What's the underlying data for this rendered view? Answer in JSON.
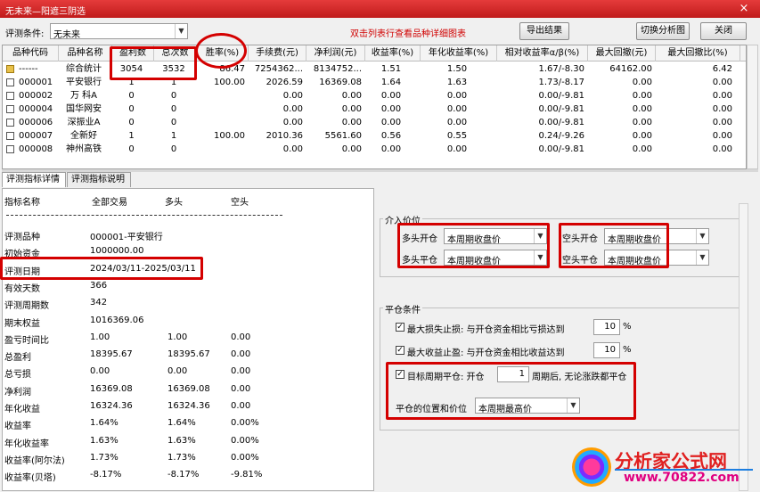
{
  "window": {
    "title": "无未来—阳遮三阴选",
    "close_label": "×"
  },
  "toolbar": {
    "condition_label": "评测条件:",
    "condition_value": "无未来",
    "hint": "双击列表行查看品种详细图表",
    "export_label": "导出结果",
    "switch_label": "切换分析图",
    "close_label": "关闭"
  },
  "grid": {
    "headers": [
      "品种代码",
      "品种名称",
      "盈利数",
      "总次数",
      "胜率(%)",
      "手续费(元)",
      "净利润(元)",
      "收益率(%)",
      "年化收益率(%)",
      "相对收益率α/β(%)",
      "最大回撤(元)",
      "最大回撤比(%)"
    ],
    "rows": [
      [
        "------",
        "综合统计",
        "3054",
        "3532",
        "86.47",
        "7254362...",
        "8134752...",
        "1.51",
        "1.50",
        "1.67/-8.30",
        "64162.00",
        "6.42"
      ],
      [
        "000001",
        "平安银行",
        "1",
        "1",
        "100.00",
        "2026.59",
        "16369.08",
        "1.64",
        "1.63",
        "1.73/-8.17",
        "0.00",
        "0.00"
      ],
      [
        "000002",
        "万 科A",
        "0",
        "0",
        "",
        "0.00",
        "0.00",
        "0.00",
        "0.00",
        "0.00/-9.81",
        "0.00",
        "0.00"
      ],
      [
        "000004",
        "国华网安",
        "0",
        "0",
        "",
        "0.00",
        "0.00",
        "0.00",
        "0.00",
        "0.00/-9.81",
        "0.00",
        "0.00"
      ],
      [
        "000006",
        "深振业A",
        "0",
        "0",
        "",
        "0.00",
        "0.00",
        "0.00",
        "0.00",
        "0.00/-9.81",
        "0.00",
        "0.00"
      ],
      [
        "000007",
        "全新好",
        "1",
        "1",
        "100.00",
        "2010.36",
        "5561.60",
        "0.56",
        "0.55",
        "0.24/-9.26",
        "0.00",
        "0.00"
      ],
      [
        "000008",
        "神州高铁",
        "0",
        "0",
        "",
        "0.00",
        "0.00",
        "0.00",
        "0.00",
        "0.00/-9.81",
        "0.00",
        "0.00"
      ]
    ]
  },
  "tabs": [
    "评测指标详情",
    "评测指标说明"
  ],
  "detail": {
    "col_headers": [
      "指标名称",
      "全部交易",
      "多头",
      "空头"
    ],
    "rows": [
      [
        "评测品种",
        "000001-平安银行",
        "",
        ""
      ],
      [
        "初始资金",
        "1000000.00",
        "",
        ""
      ],
      [
        "评测日期",
        "2024/03/11-2025/03/11",
        "",
        ""
      ],
      [
        "有效天数",
        "366",
        "",
        ""
      ],
      [
        "评测周期数",
        "342",
        "",
        ""
      ],
      [
        "期末权益",
        "1016369.06",
        "",
        ""
      ],
      [
        "盈亏时间比",
        "1.00",
        "1.00",
        "0.00"
      ],
      [
        "总盈利",
        "18395.67",
        "18395.67",
        "0.00"
      ],
      [
        "总亏损",
        "0.00",
        "0.00",
        "0.00"
      ],
      [
        "净利润",
        "16369.08",
        "16369.08",
        "0.00"
      ],
      [
        "年化收益",
        "16324.36",
        "16324.36",
        "0.00"
      ],
      [
        "收益率",
        "1.64%",
        "1.64%",
        "0.00%"
      ],
      [
        "年化收益率",
        "1.63%",
        "1.63%",
        "0.00%"
      ],
      [
        "收益率(阿尔法)",
        "1.73%",
        "1.73%",
        "0.00%"
      ],
      [
        "收益率(贝塔)",
        "-8.17%",
        "-8.17%",
        "-9.81%"
      ]
    ]
  },
  "entry_price": {
    "title": "介入价位",
    "long_open_label": "多头开仓",
    "long_open_value": "本周期收盘价",
    "short_open_label": "空头开仓",
    "short_open_value": "本周期收盘价",
    "long_close_label": "多头平仓",
    "long_close_value": "本周期收盘价",
    "short_close_label": "空头平仓",
    "short_close_value": "本周期收盘价"
  },
  "close_conditions": {
    "title": "平仓条件",
    "stop_loss_label": "最大损失止损: 与开仓资金相比亏损达到",
    "stop_loss_value": "10",
    "stop_loss_unit": "%",
    "take_profit_label": "最大收益止盈: 与开仓资金相比收益达到",
    "take_profit_value": "10",
    "take_profit_unit": "%",
    "target_period_label": "目标周期平仓: 开仓",
    "target_period_value": "1",
    "target_period_suffix": "周期后, 无论涨跌都平仓",
    "position_price_label": "平仓的位置和价位",
    "position_price_value": "本周期最高价"
  },
  "watermark": {
    "brand": "分析家公式网",
    "url": "www.70822.com"
  }
}
